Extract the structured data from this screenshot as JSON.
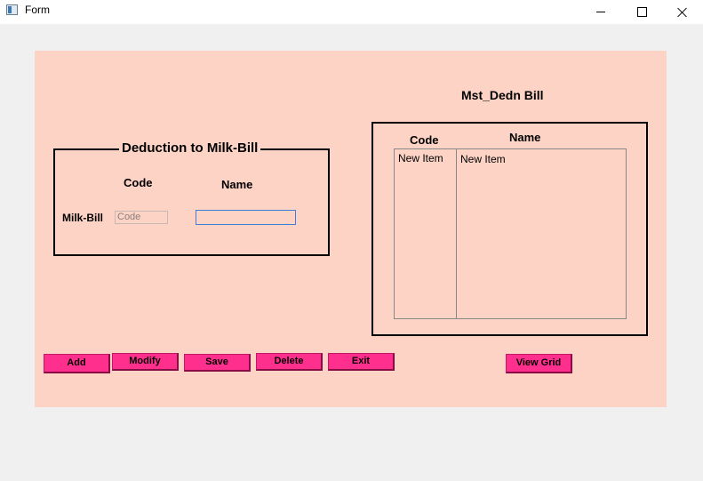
{
  "window": {
    "title": "Form"
  },
  "grid": {
    "title": "Mst_Dedn Bill",
    "code_header": "Code",
    "name_header": "Name",
    "code_item": "New Item",
    "name_item": "New Item"
  },
  "group": {
    "title": "Deduction to Milk-Bill",
    "code_label": "Code",
    "name_label": "Name",
    "row_label": "Milk-Bill",
    "code_placeholder": "Code",
    "name_value": ""
  },
  "buttons": {
    "add": "Add",
    "modify": "Modify",
    "save": "Save",
    "delete": "Delete",
    "exit": "Exit",
    "view_grid": "View Grid"
  },
  "colors": {
    "panel": "#fdd3c5",
    "button": "#ff2f8e",
    "window_bg": "#f0f0f0"
  }
}
